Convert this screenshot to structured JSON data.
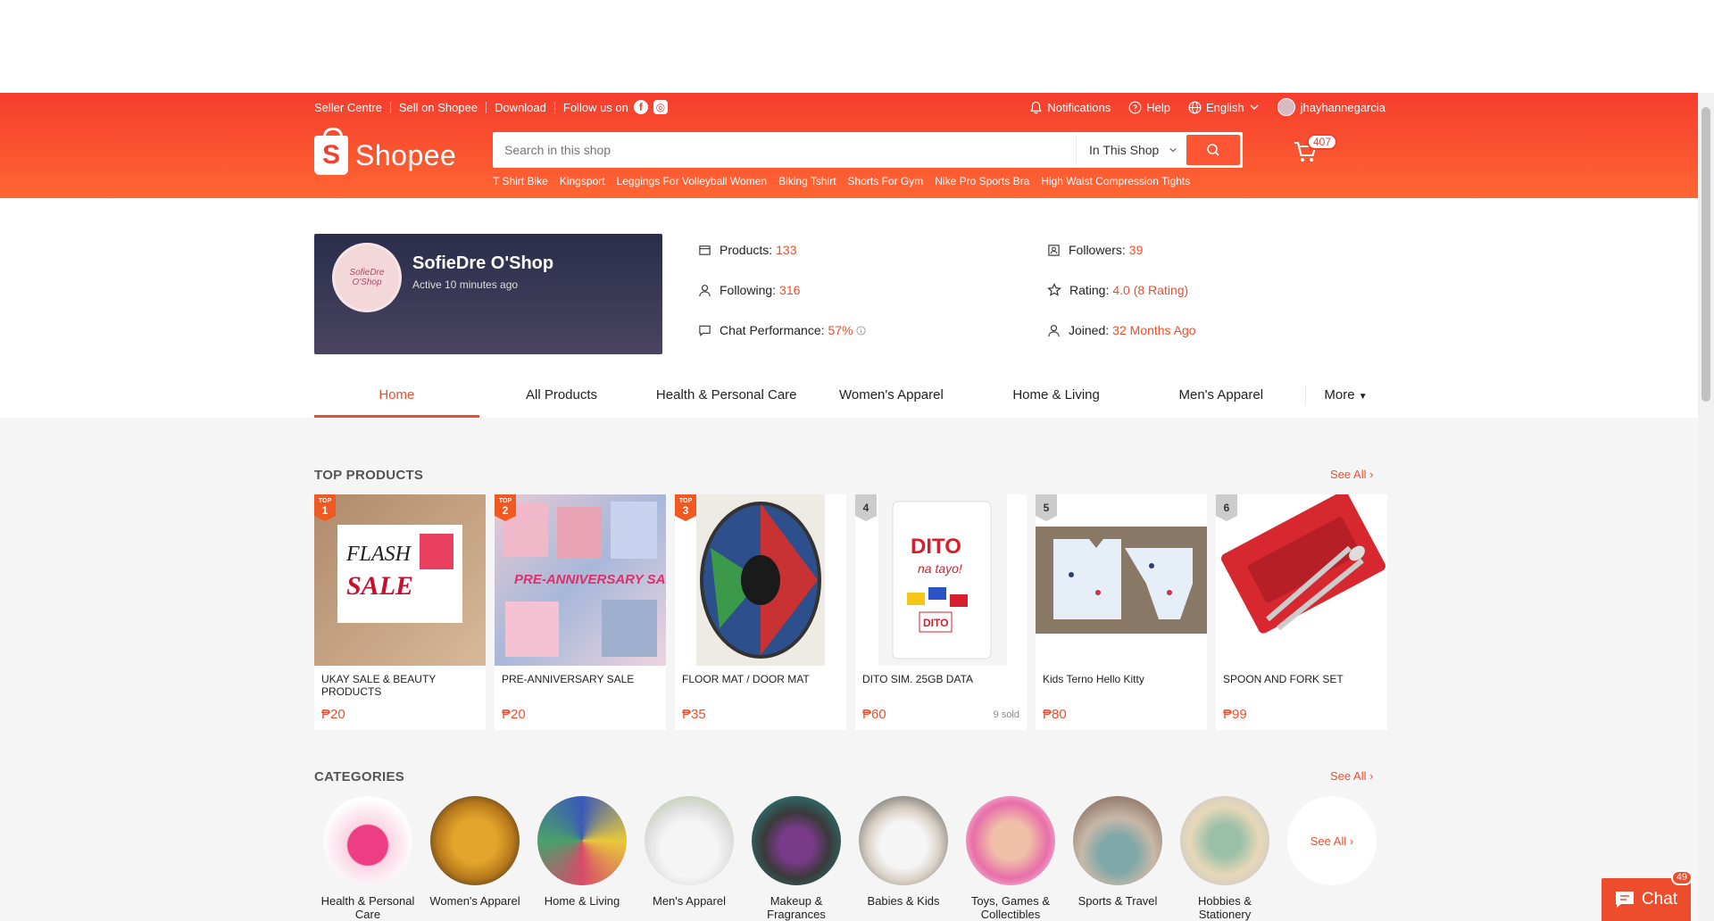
{
  "topnav": {
    "seller_centre": "Seller Centre",
    "sell_on": "Sell on Shopee",
    "download": "Download",
    "follow_us": "Follow us on",
    "notifications": "Notifications",
    "help": "Help",
    "language": "English",
    "username": "jhayhannegarcia"
  },
  "header": {
    "logo_text": "Shopee",
    "search_placeholder": "Search in this shop",
    "search_scope": "In This Shop",
    "cart_count": "407",
    "hints": [
      "T Shirt Bike",
      "Kingsport",
      "Leggings For Volleyball Women",
      "Biking Tshirt",
      "Shorts For Gym",
      "Nike Pro Sports Bra",
      "High Waist Compression Tights"
    ]
  },
  "shop": {
    "name": "SofieDre O'Shop",
    "status": "Active 10 minutes ago",
    "stats": {
      "products_label": "Products:",
      "products": "133",
      "following_label": "Following:",
      "following": "316",
      "chat_label": "Chat Performance:",
      "chat": "57%",
      "followers_label": "Followers:",
      "followers": "39",
      "rating_label": "Rating:",
      "rating": "4.0 (8 Rating)",
      "joined_label": "Joined:",
      "joined": "32 Months Ago"
    }
  },
  "tabs": [
    "Home",
    "All Products",
    "Health & Personal Care",
    "Women's Apparel",
    "Home & Living",
    "Men's Apparel",
    "More"
  ],
  "top_products": {
    "title": "TOP PRODUCTS",
    "see_all": "See All",
    "items": [
      {
        "rank": "1",
        "name": "UKAY SALE & BEAUTY PRODUCTS",
        "price": "₱20",
        "sold": ""
      },
      {
        "rank": "2",
        "name": "PRE-ANNIVERSARY SALE",
        "price": "₱20",
        "sold": ""
      },
      {
        "rank": "3",
        "name": "FLOOR MAT / DOOR MAT",
        "price": "₱35",
        "sold": ""
      },
      {
        "rank": "4",
        "name": "DITO SIM. 25GB DATA",
        "price": "₱60",
        "sold": "9 sold"
      },
      {
        "rank": "5",
        "name": "Kids Terno Hello Kitty",
        "price": "₱80",
        "sold": ""
      },
      {
        "rank": "6",
        "name": "SPOON AND FORK SET",
        "price": "₱99",
        "sold": ""
      }
    ]
  },
  "categories": {
    "title": "CATEGORIES",
    "see_all": "See All",
    "items": [
      "Health & Personal Care",
      "Women's Apparel",
      "Home & Living",
      "Men's Apparel",
      "Makeup & Fragrances",
      "Babies & Kids",
      "Toys, Games & Collectibles",
      "Sports & Travel",
      "Hobbies & Stationery"
    ],
    "see_all_circle": "See All"
  },
  "chat": {
    "label": "Chat",
    "badge": "49"
  },
  "colors": {
    "brand": "#ee4d2d",
    "header_start": "#f53d2d",
    "header_end": "#ff6633"
  }
}
